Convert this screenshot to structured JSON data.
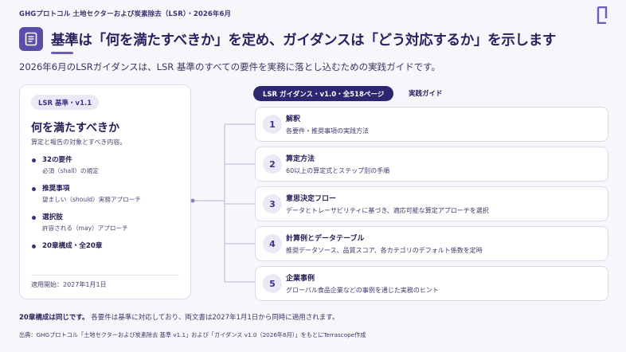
{
  "header": {
    "breadcrumb": "GHGプロトコル 土地セクターおよび炭素除去（LSR）・2026年6月",
    "title": "基準は「何を満たすべきか」を定め、ガイダンスは「どう対応するか」を示します",
    "subtitle": "2026年6月のLSRガイダンスは、LSR 基準のすべての要件を実務に落とし込むための実践ガイドです。"
  },
  "left_card": {
    "badge": "LSR 基準・v1.1",
    "title": "何を満たすべきか",
    "subtitle": "算定と報告の対象とすべき内容。",
    "items": [
      {
        "heading": "32の要件",
        "desc": "必須（shall）の規定"
      },
      {
        "heading": "推奨事項",
        "desc": "望ましい（should）実務アプローチ"
      },
      {
        "heading": "選択肢",
        "desc": "許容される（may）アプローチ"
      },
      {
        "heading": "20章構成・全20章",
        "desc": ""
      }
    ],
    "footer": "適用開始：2027年1月1日"
  },
  "right": {
    "pill": "LSR ガイダンス・v1.0・全518ページ",
    "label": "実践ガイド",
    "steps": [
      {
        "num": "1",
        "heading": "解釈",
        "desc": "各要件・推奨事項の実践方法"
      },
      {
        "num": "2",
        "heading": "算定方法",
        "desc": "60以上の算定式とステップ別の手順"
      },
      {
        "num": "3",
        "heading": "意思決定フロー",
        "desc": "データとトレーサビリティに基づき、適応可能な算定アプローチを選択"
      },
      {
        "num": "4",
        "heading": "計算例とデータテーブル",
        "desc": "推奨データソース、品質スコア、各カテゴリのデフォルト係数を定時"
      },
      {
        "num": "5",
        "heading": "企業事例",
        "desc": "グローバル食品企業などの事例を通じた実務のヒント"
      }
    ]
  },
  "note": {
    "bold": "20章構成は同じです。",
    "text": "各要件は基準に対応しており、両文書は2027年1月1日から同時に適用されます。"
  },
  "source": "出典：GHGプロトコル「土地セクターおよび炭素除去 基準 v1.1」および「ガイダンス v1.0（2026年6月）」をもとにTerrascope作成",
  "colors": {
    "accent": "#5a4fa7",
    "dark": "#2d2670",
    "badge_bg": "#ebe8f7"
  }
}
